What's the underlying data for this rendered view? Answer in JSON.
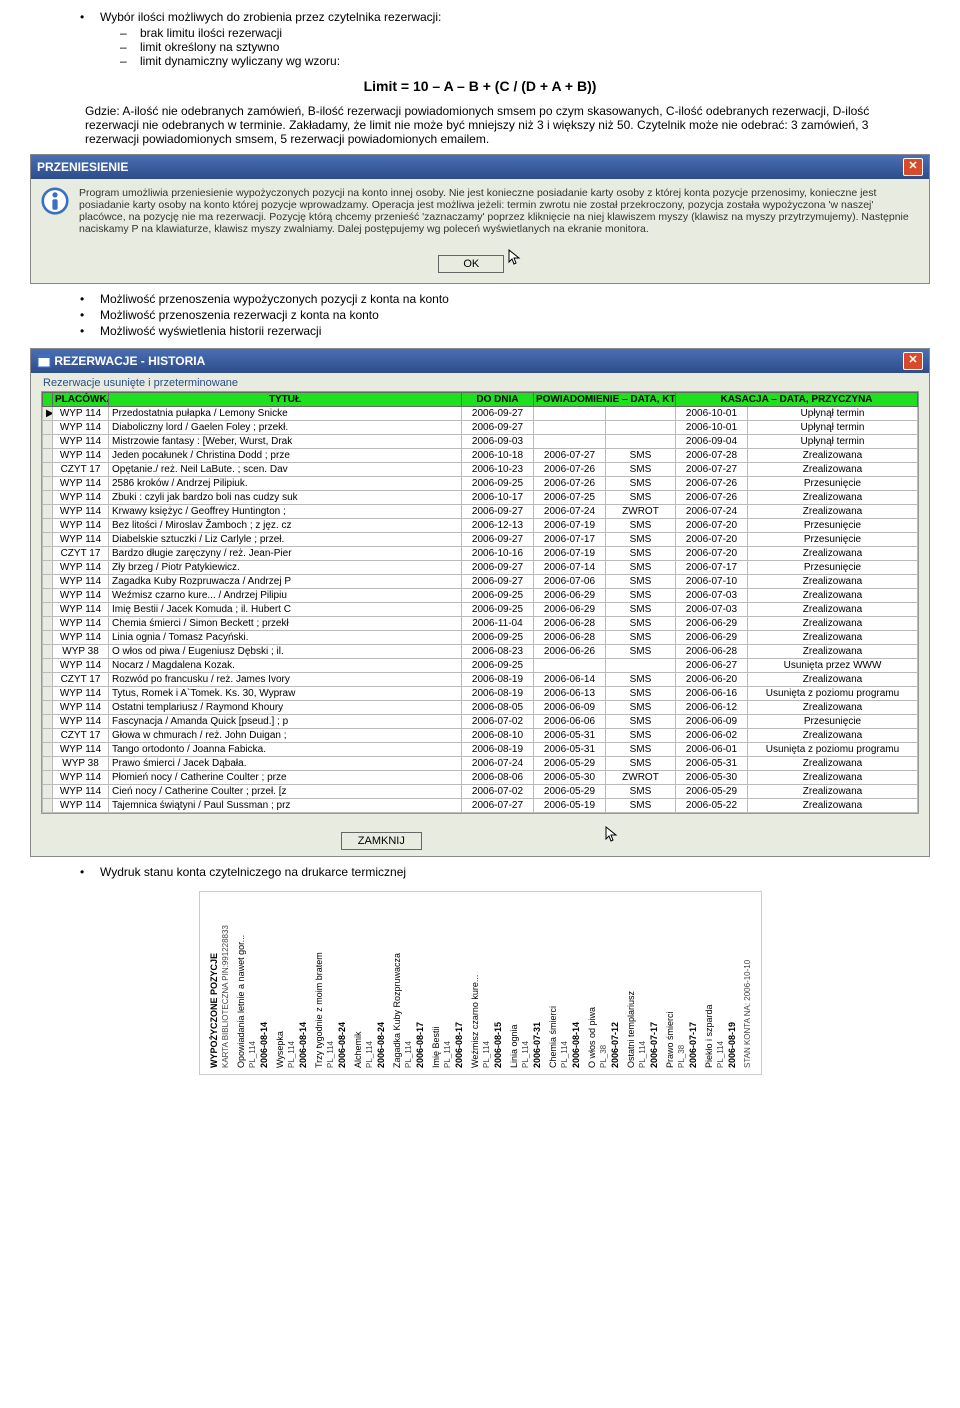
{
  "intro": {
    "line1": "Wybór ilości możliwych do zrobienia przez czytelnika rezerwacji:",
    "s1": "brak limitu ilości rezerwacji",
    "s2": "limit określony na sztywno",
    "s3": "limit dynamiczny wyliczany wg wzoru:",
    "formula": "Limit = 10 – A – B + (C / (D + A + B))",
    "desc": "Gdzie: A-ilość nie odebranych zamówień, B-ilość rezerwacji powiadomionych smsem po czym skasowanych, C-ilość odebranych rezerwacji, D-ilość rezerwacji nie odebranych w terminie. Zakładamy, że limit nie może być mniejszy niż 3 i większy niż 50. Czytelnik może nie odebrać: 3 zamówień, 3 rezerwacji powiadomionych smsem, 5 rezerwacji powiadomionych emailem."
  },
  "dlg1": {
    "title": "PRZENIESIENIE",
    "text": "Program umożliwia przeniesienie wypożyczonych pozycji na konto innej osoby. Nie jest konieczne posiadanie karty osoby z której konta pozycje przenosimy, konieczne jest posiadanie karty osoby na konto której pozycje wprowadzamy. Operacja jest możliwa jeżeli: termin zwrotu nie został przekroczony, pozycja została wypożyczona 'w naszej' placówce, na pozycję nie ma rezerwacji. Pozycję którą chcemy przenieść 'zaznaczamy' poprzez kliknięcie na niej klawiszem myszy (klawisz na myszy przytrzymujemy). Następnie naciskamy P na klawiaturze, klawisz myszy zwalniamy. Dalej postępujemy wg poleceń wyświetlanych na ekranie monitora.",
    "ok": "OK"
  },
  "bul2": {
    "b1": "Możliwość przenoszenia wypożyczonych pozycji z konta na konto",
    "b2": "Możliwość przenoszenia rezerwacji z konta na konto",
    "b3": "Możliwość wyświetlenia historii rezerwacji"
  },
  "dlg2": {
    "title": "REZERWACJE - HISTORIA",
    "group": "Rezerwacje usunięte i przeterminowane",
    "cols": {
      "plac": "PLACÓWKA",
      "title": "TYTUŁ",
      "do": "DO DNIA",
      "pow": "POWIADOMIENIE – DATA, KTO",
      "kas": "KASACJA – DATA, PRZYCZYNA"
    },
    "rows": [
      {
        "p": "WYP 114",
        "t": "Przedostatnia pułapka /   Lemony Snicke",
        "d": "2006-09-27",
        "pd": "",
        "pw": "",
        "kd": "2006-10-01",
        "kr": "Upłynął termin"
      },
      {
        "p": "WYP 114",
        "t": "Diaboliczny lord /   Gaelen Foley ; przekł.",
        "d": "2006-09-27",
        "pd": "",
        "pw": "",
        "kd": "2006-10-01",
        "kr": "Upłynął termin"
      },
      {
        "p": "WYP 114",
        "t": "Mistrzowie fantasy : [Weber, Wurst, Drak",
        "d": "2006-09-03",
        "pd": "",
        "pw": "",
        "kd": "2006-09-04",
        "kr": "Upłynął termin"
      },
      {
        "p": "WYP 114",
        "t": "Jeden pocałunek /   Christina Dodd ; prze",
        "d": "2006-10-18",
        "pd": "2006-07-27",
        "pw": "SMS",
        "kd": "2006-07-28",
        "kr": "Zrealizowana"
      },
      {
        "p": "CZYT 17",
        "t": "Opętanie./   reż. Neil LaBute. ; scen. Dav",
        "d": "2006-10-23",
        "pd": "2006-07-26",
        "pw": "SMS",
        "kd": "2006-07-27",
        "kr": "Zrealizowana"
      },
      {
        "p": "WYP 114",
        "t": "2586 kroków /   Andrzej Pilipiuk.",
        "d": "2006-09-25",
        "pd": "2006-07-26",
        "pw": "SMS",
        "kd": "2006-07-26",
        "kr": "Przesunięcie"
      },
      {
        "p": "WYP 114",
        "t": "Zbuki : czyli jak bardzo boli nas cudzy suk",
        "d": "2006-10-17",
        "pd": "2006-07-25",
        "pw": "SMS",
        "kd": "2006-07-26",
        "kr": "Zrealizowana"
      },
      {
        "p": "WYP 114",
        "t": "Krwawy księżyc /   Geoffrey Huntington ;",
        "d": "2006-09-27",
        "pd": "2006-07-24",
        "pw": "ZWROT",
        "kd": "2006-07-24",
        "kr": "Zrealizowana"
      },
      {
        "p": "WYP 114",
        "t": "Bez litości /   Miroslav Žamboch ; z jęz. cz",
        "d": "2006-12-13",
        "pd": "2006-07-19",
        "pw": "SMS",
        "kd": "2006-07-20",
        "kr": "Przesunięcie"
      },
      {
        "p": "WYP 114",
        "t": "Diabelskie sztuczki /   Liz Carlyle ; przeł.",
        "d": "2006-09-27",
        "pd": "2006-07-17",
        "pw": "SMS",
        "kd": "2006-07-20",
        "kr": "Przesunięcie"
      },
      {
        "p": "CZYT 17",
        "t": "Bardzo długie zaręczyny /   reż. Jean-Pier",
        "d": "2006-10-16",
        "pd": "2006-07-19",
        "pw": "SMS",
        "kd": "2006-07-20",
        "kr": "Zrealizowana"
      },
      {
        "p": "WYP 114",
        "t": "Zły brzeg /   Piotr Patykiewicz.",
        "d": "2006-09-27",
        "pd": "2006-07-14",
        "pw": "SMS",
        "kd": "2006-07-17",
        "kr": "Przesunięcie"
      },
      {
        "p": "WYP 114",
        "t": "Zagadka Kuby Rozpruwacza /   Andrzej P",
        "d": "2006-09-27",
        "pd": "2006-07-06",
        "pw": "SMS",
        "kd": "2006-07-10",
        "kr": "Zrealizowana"
      },
      {
        "p": "WYP 114",
        "t": "Weźmisz czarno kure... /   Andrzej Pilipiu",
        "d": "2006-09-25",
        "pd": "2006-06-29",
        "pw": "SMS",
        "kd": "2006-07-03",
        "kr": "Zrealizowana"
      },
      {
        "p": "WYP 114",
        "t": "Imię Bestii /   Jacek Komuda ; il. Hubert C",
        "d": "2006-09-25",
        "pd": "2006-06-29",
        "pw": "SMS",
        "kd": "2006-07-03",
        "kr": "Zrealizowana"
      },
      {
        "p": "WYP 114",
        "t": "Chemia śmierci /   Simon Beckett ; przekł",
        "d": "2006-11-04",
        "pd": "2006-06-28",
        "pw": "SMS",
        "kd": "2006-06-29",
        "kr": "Zrealizowana"
      },
      {
        "p": "WYP 114",
        "t": "Linia ognia /   Tomasz Pacyński.",
        "d": "2006-09-25",
        "pd": "2006-06-28",
        "pw": "SMS",
        "kd": "2006-06-29",
        "kr": "Zrealizowana"
      },
      {
        "p": "WYP 38",
        "t": "O włos od piwa /   Eugeniusz Dębski ; il.",
        "d": "2006-08-23",
        "pd": "2006-06-26",
        "pw": "SMS",
        "kd": "2006-06-28",
        "kr": "Zrealizowana"
      },
      {
        "p": "WYP 114",
        "t": "Nocarz /   Magdalena Kozak.",
        "d": "2006-09-25",
        "pd": "",
        "pw": "",
        "kd": "2006-06-27",
        "kr": "Usunięta przez WWW"
      },
      {
        "p": "CZYT 17",
        "t": "Rozwód po francusku /   reż. James Ivory",
        "d": "2006-08-19",
        "pd": "2006-06-14",
        "pw": "SMS",
        "kd": "2006-06-20",
        "kr": "Zrealizowana"
      },
      {
        "p": "WYP 114",
        "t": "Tytus, Romek i A`Tomek. Ks. 30, Wypraw",
        "d": "2006-08-19",
        "pd": "2006-06-13",
        "pw": "SMS",
        "kd": "2006-06-16",
        "kr": "Usunięta z poziomu programu"
      },
      {
        "p": "WYP 114",
        "t": "Ostatni templariusz /   Raymond Khoury",
        "d": "2006-08-05",
        "pd": "2006-06-09",
        "pw": "SMS",
        "kd": "2006-06-12",
        "kr": "Zrealizowana"
      },
      {
        "p": "WYP 114",
        "t": "Fascynacja /   Amanda Quick [pseud.] ; p",
        "d": "2006-07-02",
        "pd": "2006-06-06",
        "pw": "SMS",
        "kd": "2006-06-09",
        "kr": "Przesunięcie"
      },
      {
        "p": "CZYT 17",
        "t": "Głowa w chmurach /   reż. John Duigan ;",
        "d": "2006-08-10",
        "pd": "2006-05-31",
        "pw": "SMS",
        "kd": "2006-06-02",
        "kr": "Zrealizowana"
      },
      {
        "p": "WYP 114",
        "t": "Tango ortodonto /   Joanna Fabicka.",
        "d": "2006-08-19",
        "pd": "2006-05-31",
        "pw": "SMS",
        "kd": "2006-06-01",
        "kr": "Usunięta z poziomu programu"
      },
      {
        "p": "WYP 38",
        "t": "Prawo śmierci /   Jacek Dąbała.",
        "d": "2006-07-24",
        "pd": "2006-05-29",
        "pw": "SMS",
        "kd": "2006-05-31",
        "kr": "Zrealizowana"
      },
      {
        "p": "WYP 114",
        "t": "Płomień nocy /   Catherine Coulter ; prze",
        "d": "2006-08-06",
        "pd": "2006-05-30",
        "pw": "ZWROT",
        "kd": "2006-05-30",
        "kr": "Zrealizowana"
      },
      {
        "p": "WYP 114",
        "t": "Cień nocy /   Catherine Coulter ; przeł. [z",
        "d": "2006-07-02",
        "pd": "2006-05-29",
        "pw": "SMS",
        "kd": "2006-05-29",
        "kr": "Zrealizowana"
      },
      {
        "p": "WYP 114",
        "t": "Tajemnica świątyni /   Paul Sussman ; prz",
        "d": "2006-07-27",
        "pd": "2006-05-19",
        "pw": "SMS",
        "kd": "2006-05-22",
        "kr": "Zrealizowana"
      }
    ],
    "close": "ZAMKNIJ"
  },
  "bul3": "Wydruk stanu konta czytelniczego na drukarce termicznej",
  "receipt": {
    "head1": "WYPOŻYCZONE POZYCJE",
    "head2": "KARTA BIBLIOTECZNA PIN:991228833",
    "items": [
      {
        "t": "Opowiadania letnie a nawet gor...",
        "p": "PL_114",
        "d": "2006-08-14"
      },
      {
        "t": "Wysepka",
        "p": "PL_114",
        "d": "2006-08-14"
      },
      {
        "t": "Trzy tygodnie z moim bratem",
        "p": "PL_114",
        "d": "2006-08-24"
      },
      {
        "t": "Alchemik",
        "p": "PL_114",
        "d": "2006-08-24"
      },
      {
        "t": "Zagadka Kuby Rozpruwacza",
        "p": "PL_114",
        "d": "2006-08-17"
      },
      {
        "t": "Imię Bestii",
        "p": "PL_114",
        "d": "2006-08-17"
      },
      {
        "t": "Weźmisz czarno kure...",
        "p": "PL_114",
        "d": "2006-08-15"
      },
      {
        "t": "Linia ognia",
        "p": "PL_114",
        "d": "2006-07-31"
      },
      {
        "t": "Chemia śmierci",
        "p": "PL_114",
        "d": "2006-08-14"
      },
      {
        "t": "O włos od piwa",
        "p": "PL_38",
        "d": "2006-07-12"
      },
      {
        "t": "Ostatni templariusz",
        "p": "PL_114",
        "d": "2006-07-17"
      },
      {
        "t": "Prawo śmierci",
        "p": "PL_38",
        "d": "2006-07-17"
      },
      {
        "t": "Piekło i szparda",
        "p": "PL_114",
        "d": "2006-08-19"
      }
    ],
    "footer": "STAN KONTA NA: 2006-10-10"
  }
}
